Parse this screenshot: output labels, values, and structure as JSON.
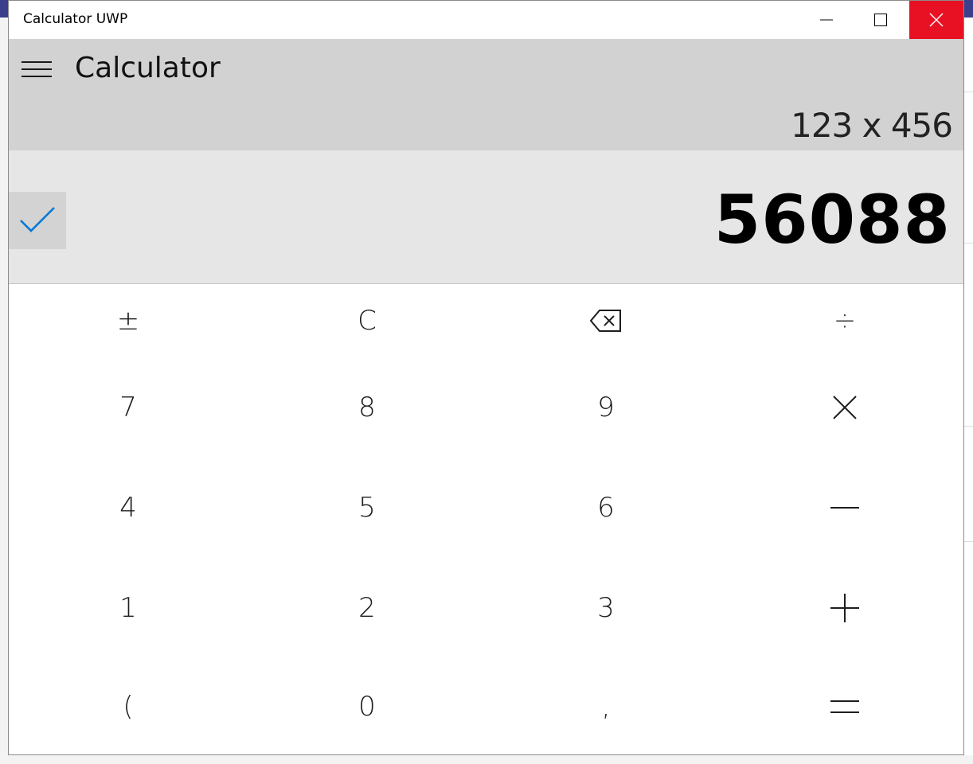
{
  "window": {
    "title": "Calculator UWP"
  },
  "header": {
    "app_title": "Calculator",
    "menu_icon": "hamburger-menu-icon"
  },
  "display": {
    "expression": "123 x 456",
    "result": "56088",
    "confirm_icon": "checkmark-icon"
  },
  "keypad": {
    "row1": {
      "plus_minus": "±",
      "clear": "C",
      "backspace_icon": "backspace-icon",
      "divide": "÷"
    },
    "row2": {
      "seven": "7",
      "eight": "8",
      "nine": "9",
      "multiply_icon": "multiply-icon"
    },
    "row3": {
      "four": "4",
      "five": "5",
      "six": "6",
      "minus_icon": "minus-icon"
    },
    "row4": {
      "one": "1",
      "two": "2",
      "three": "3",
      "plus_icon": "plus-icon"
    },
    "row5": {
      "open_paren": "(",
      "zero": "0",
      "decimal": ",",
      "equals_icon": "equals-icon"
    }
  },
  "colors": {
    "close_button": "#e81123",
    "accent": "#0078d7",
    "header_bg": "#d2d2d2",
    "result_bg": "#e6e6e6"
  }
}
